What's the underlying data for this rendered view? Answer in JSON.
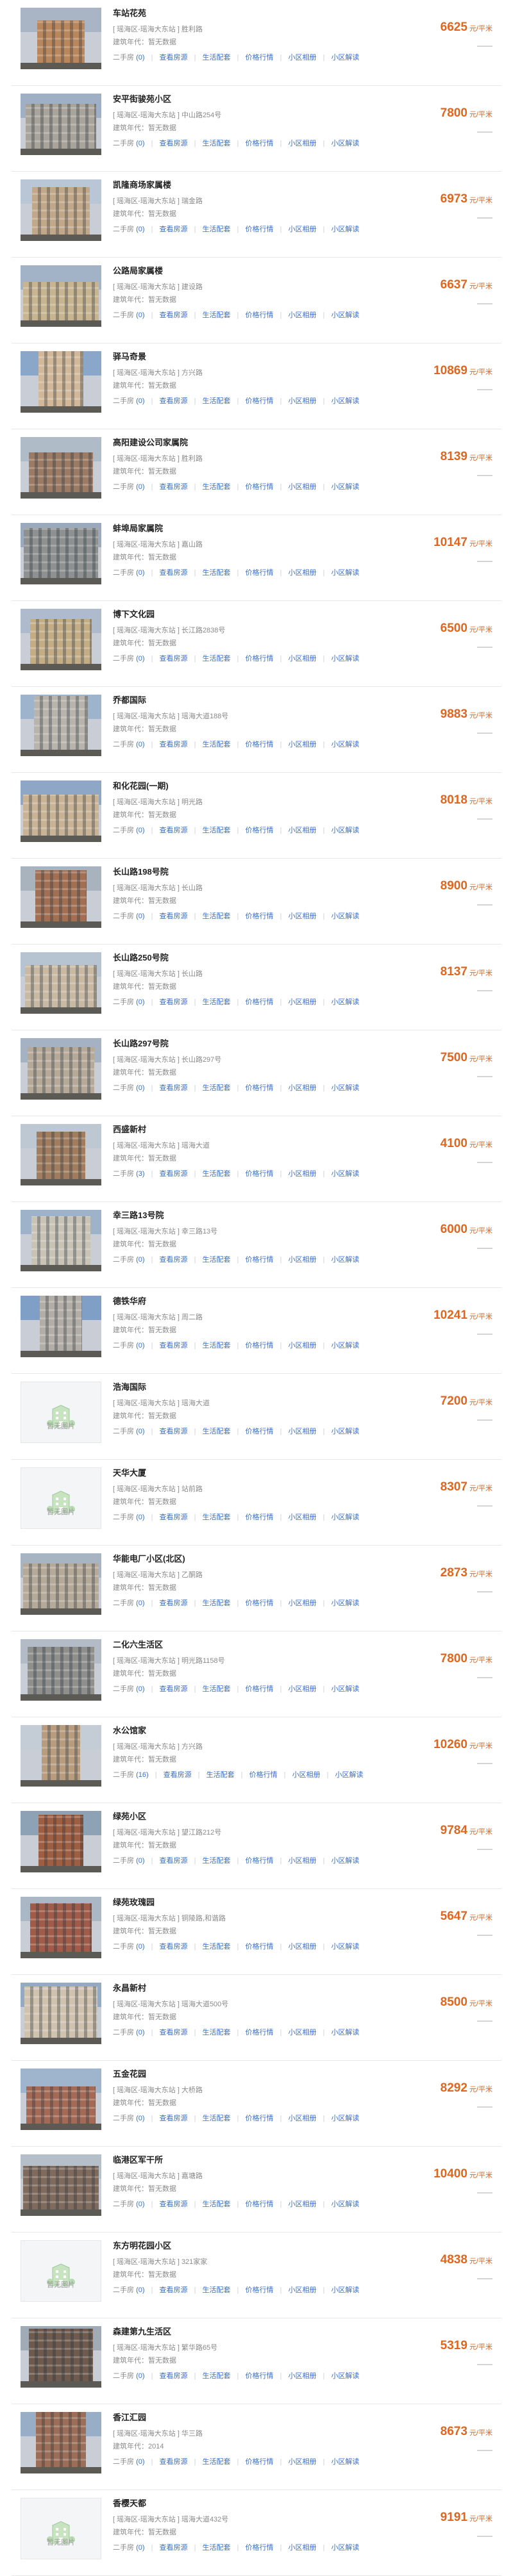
{
  "labels": {
    "secondhand": "二手房",
    "view_listings": "查看房源",
    "amenities": "生活配套",
    "price_trend": "价格行情",
    "estate_photos": "小区相册",
    "estate_review": "小区解读",
    "unit": "元/平米",
    "placeholder_image": "暂无图片",
    "trend_dash": "——"
  },
  "items": [
    {
      "name": "车站花苑",
      "address": "[ 瑶海区-瑶海大东站 ] 胜利路",
      "build_year": "建筑年代：暂无数据",
      "count": "(0)",
      "price": "6625",
      "photo": {
        "sky": "#a9b4c4",
        "wall": "#b9875e",
        "w": 74,
        "h": 66
      }
    },
    {
      "name": "安平街骏苑小区",
      "address": "[ 瑶海区-瑶海大东站 ] 中山路254号",
      "build_year": "建筑年代：暂无数据",
      "count": "(0)",
      "price": "7800",
      "photo": {
        "sky": "#9fb0c6",
        "wall": "#a8a49c",
        "w": 110,
        "h": 70
      }
    },
    {
      "name": "凯隆商场家属楼",
      "address": "[ 瑶海区-瑶海大东站 ] 瑞金路",
      "build_year": "建筑年代：暂无数据",
      "count": "(0)",
      "price": "6973",
      "photo": {
        "sky": "#b9c6d6",
        "wall": "#c1a88a",
        "w": 90,
        "h": 74
      }
    },
    {
      "name": "公路局家属楼",
      "address": "[ 瑶海区-瑶海大东站 ] 建设路",
      "build_year": "建筑年代：暂无数据",
      "count": "(0)",
      "price": "6637",
      "photo": {
        "sky": "#a2b3c8",
        "wall": "#c7b592",
        "w": 118,
        "h": 60
      }
    },
    {
      "name": "驿马奇景",
      "address": "[ 瑶海区-瑶海大东站 ] 方兴路",
      "build_year": "建筑年代：暂无数据",
      "count": "(0)",
      "price": "10869",
      "photo": {
        "sky": "#8aa6c8",
        "wall": "#d2b89a",
        "w": 70,
        "h": 86
      }
    },
    {
      "name": "高阳建设公司家属院",
      "address": "[ 瑶海区-瑶海大东站 ] 胜利路",
      "build_year": "建筑年代：暂无数据",
      "count": "(0)",
      "price": "8139",
      "photo": {
        "sky": "#b0bbc8",
        "wall": "#9c7a63",
        "w": 100,
        "h": 62
      }
    },
    {
      "name": "蚌埠局家属院",
      "address": "[ 瑶海区-瑶海大东站 ] 嘉山路",
      "build_year": "建筑年代：暂无数据",
      "count": "(0)",
      "price": "10147",
      "photo": {
        "sky": "#9aa9bb",
        "wall": "#8e918f",
        "w": 116,
        "h": 78
      }
    },
    {
      "name": "博下文化园",
      "address": "[ 瑶海区-瑶海大东站 ] 长江路2838号",
      "build_year": "建筑年代：暂无数据",
      "count": "(0)",
      "price": "6500",
      "photo": {
        "sky": "#aebbcc",
        "wall": "#c4ad85",
        "w": 96,
        "h": 70
      }
    },
    {
      "name": "乔都国际",
      "address": "[ 瑶海区-瑶海大东站 ] 瑶海大道188号",
      "build_year": "建筑年代：暂无数据",
      "count": "(0)",
      "price": "9883",
      "photo": {
        "sky": "#9db4cc",
        "wall": "#b9b4ab",
        "w": 84,
        "h": 84
      }
    },
    {
      "name": "和化花园(一期)",
      "address": "[ 瑶海区-瑶海大东站 ] 明光路",
      "build_year": "建筑年代：暂无数据",
      "count": "(0)",
      "price": "8018",
      "photo": {
        "sky": "#8ea7c6",
        "wall": "#c8b396",
        "w": 118,
        "h": 64
      }
    },
    {
      "name": "长山路198号院",
      "address": "[ 瑶海区-瑶海大东站 ] 长山路",
      "build_year": "建筑年代：暂无数据",
      "count": "(0)",
      "price": "8900",
      "photo": {
        "sky": "#a9b3be",
        "wall": "#a36f52",
        "w": 80,
        "h": 80
      }
    },
    {
      "name": "长山路250号院",
      "address": "[ 瑶海区-瑶海大东站 ] 长山路",
      "build_year": "建筑年代：暂无数据",
      "count": "(0)",
      "price": "8137",
      "photo": {
        "sky": "#b6c3d1",
        "wall": "#c9b9a2",
        "w": 112,
        "h": 66
      }
    },
    {
      "name": "长山路297号院",
      "address": "[ 瑶海区-瑶海大东站 ] 长山路297号",
      "build_year": "建筑年代：暂无数据",
      "count": "(0)",
      "price": "7500",
      "photo": {
        "sky": "#a4b2c2",
        "wall": "#b7a998",
        "w": 104,
        "h": 72
      }
    },
    {
      "name": "西盛新村",
      "address": "[ 瑶海区-瑶海大东站 ] 瑶海大道",
      "build_year": "建筑年代：暂无数据",
      "count": "(3)",
      "price": "4100",
      "photo": {
        "sky": "#bec8d2",
        "wall": "#a27c5e",
        "w": 76,
        "h": 74
      }
    },
    {
      "name": "幸三路13号院",
      "address": "[ 瑶海区-瑶海大东站 ] 幸三路13号",
      "build_year": "建筑年代：暂无数据",
      "count": "(0)",
      "price": "6000",
      "photo": {
        "sky": "#9eb3c9",
        "wall": "#c9c3b5",
        "w": 92,
        "h": 76
      }
    },
    {
      "name": "德铁华府",
      "address": "[ 瑶海区-瑶海大东站 ] 周二路",
      "build_year": "建筑年代：暂无数据",
      "count": "(0)",
      "price": "10241",
      "photo": {
        "sky": "#7f9fc7",
        "wall": "#b2aea7",
        "w": 66,
        "h": 88
      }
    },
    {
      "name": "浩海国际",
      "address": "[ 瑶海区-瑶海大东站 ] 瑶海大道",
      "build_year": "建筑年代：暂无数据",
      "count": "(0)",
      "price": "7200",
      "placeholder": true
    },
    {
      "name": "天华大厦",
      "address": "[ 瑶海区-瑶海大东站 ] 站前路",
      "build_year": "建筑年代：暂无数据",
      "count": "(0)",
      "price": "8307",
      "placeholder": true
    },
    {
      "name": "华能电厂小区(北区)",
      "address": "[ 瑶海区-瑶海大东站 ] 乙酮路",
      "build_year": "建筑年代：暂无数据",
      "count": "(0)",
      "price": "2873",
      "photo": {
        "sky": "#a7b4c2",
        "wall": "#b5aa99",
        "w": 118,
        "h": 70
      }
    },
    {
      "name": "二化六生活区",
      "address": "[ 瑶海区-瑶海大东站 ] 明光路1158号",
      "build_year": "建筑年代：暂无数据",
      "count": "(0)",
      "price": "7800",
      "photo": {
        "sky": "#b3bcc6",
        "wall": "#8f8f8c",
        "w": 104,
        "h": 74
      }
    },
    {
      "name": "水公馆家",
      "address": "[ 瑶海区-瑶海大东站 ] 方兴路",
      "build_year": "建筑年代：暂无数据",
      "count": "(16)",
      "price": "10260",
      "photo": {
        "sky": "#c4cdd6",
        "wall": "#b89c7d",
        "w": 60,
        "h": 90
      }
    },
    {
      "name": "绿苑小区",
      "address": "[ 瑶海区-瑶海大东站 ] 望江路212号",
      "build_year": "建筑年代：暂无数据",
      "count": "(0)",
      "price": "9784",
      "photo": {
        "sky": "#8ea2b5",
        "wall": "#9c5f43",
        "w": 70,
        "h": 80
      }
    },
    {
      "name": "绿苑玫瑰园",
      "address": "[ 瑶海区-瑶海大东站 ] 铜陵路,和谐路",
      "build_year": "建筑年代：暂无数据",
      "count": "(0)",
      "price": "5647",
      "photo": {
        "sky": "#aab7c5",
        "wall": "#a05c48",
        "w": 96,
        "h": 76
      }
    },
    {
      "name": "永昌新村",
      "address": "[ 瑶海区-瑶海大东站 ] 瑶海大道500号",
      "build_year": "建筑年代：暂无数据",
      "count": "(0)",
      "price": "8500",
      "photo": {
        "sky": "#93aac2",
        "wall": "#cfc2ae",
        "w": 114,
        "h": 80
      }
    },
    {
      "name": "五金花园",
      "address": "[ 瑶海区-瑶海大东站 ] 大桥路",
      "build_year": "建筑年代：暂无数据",
      "count": "(0)",
      "price": "8292",
      "photo": {
        "sky": "#9fb5cd",
        "wall": "#a56a55",
        "w": 108,
        "h": 58
      }
    },
    {
      "name": "临港区军干所",
      "address": "[ 瑶海区-瑶海大东站 ] 嘉塘路",
      "build_year": "建筑年代：暂无数据",
      "count": "(0)",
      "price": "10400",
      "photo": {
        "sky": "#b5bfca",
        "wall": "#7f6a5e",
        "w": 118,
        "h": 68
      }
    },
    {
      "name": "东方明花园小区",
      "address": "[ 瑶海区-瑶海大东站 ] 321家家",
      "build_year": "建筑年代：暂无数据",
      "count": "(0)",
      "price": "4838",
      "placeholder": true
    },
    {
      "name": "森建第九生活区",
      "address": "[ 瑶海区-瑶海大东站 ] 繁华路65号",
      "build_year": "建筑年代：暂无数据",
      "count": "(0)",
      "price": "5319",
      "photo": {
        "sky": "#a1abb6",
        "wall": "#6f5a4d",
        "w": 100,
        "h": 82
      }
    },
    {
      "name": "香江汇园",
      "address": "[ 瑶海区-瑶海大东站 ] 华三路",
      "build_year": "建筑年代：2014",
      "count": "(0)",
      "price": "8673",
      "photo": {
        "sky": "#98aec6",
        "wall": "#9a6e58",
        "w": 78,
        "h": 86
      }
    },
    {
      "name": "香樱天都",
      "address": "[ 瑶海区-瑶海大东站 ] 瑶海大道432号",
      "build_year": "建筑年代：暂无数据",
      "count": "(0)",
      "price": "9191",
      "placeholder": true
    }
  ]
}
